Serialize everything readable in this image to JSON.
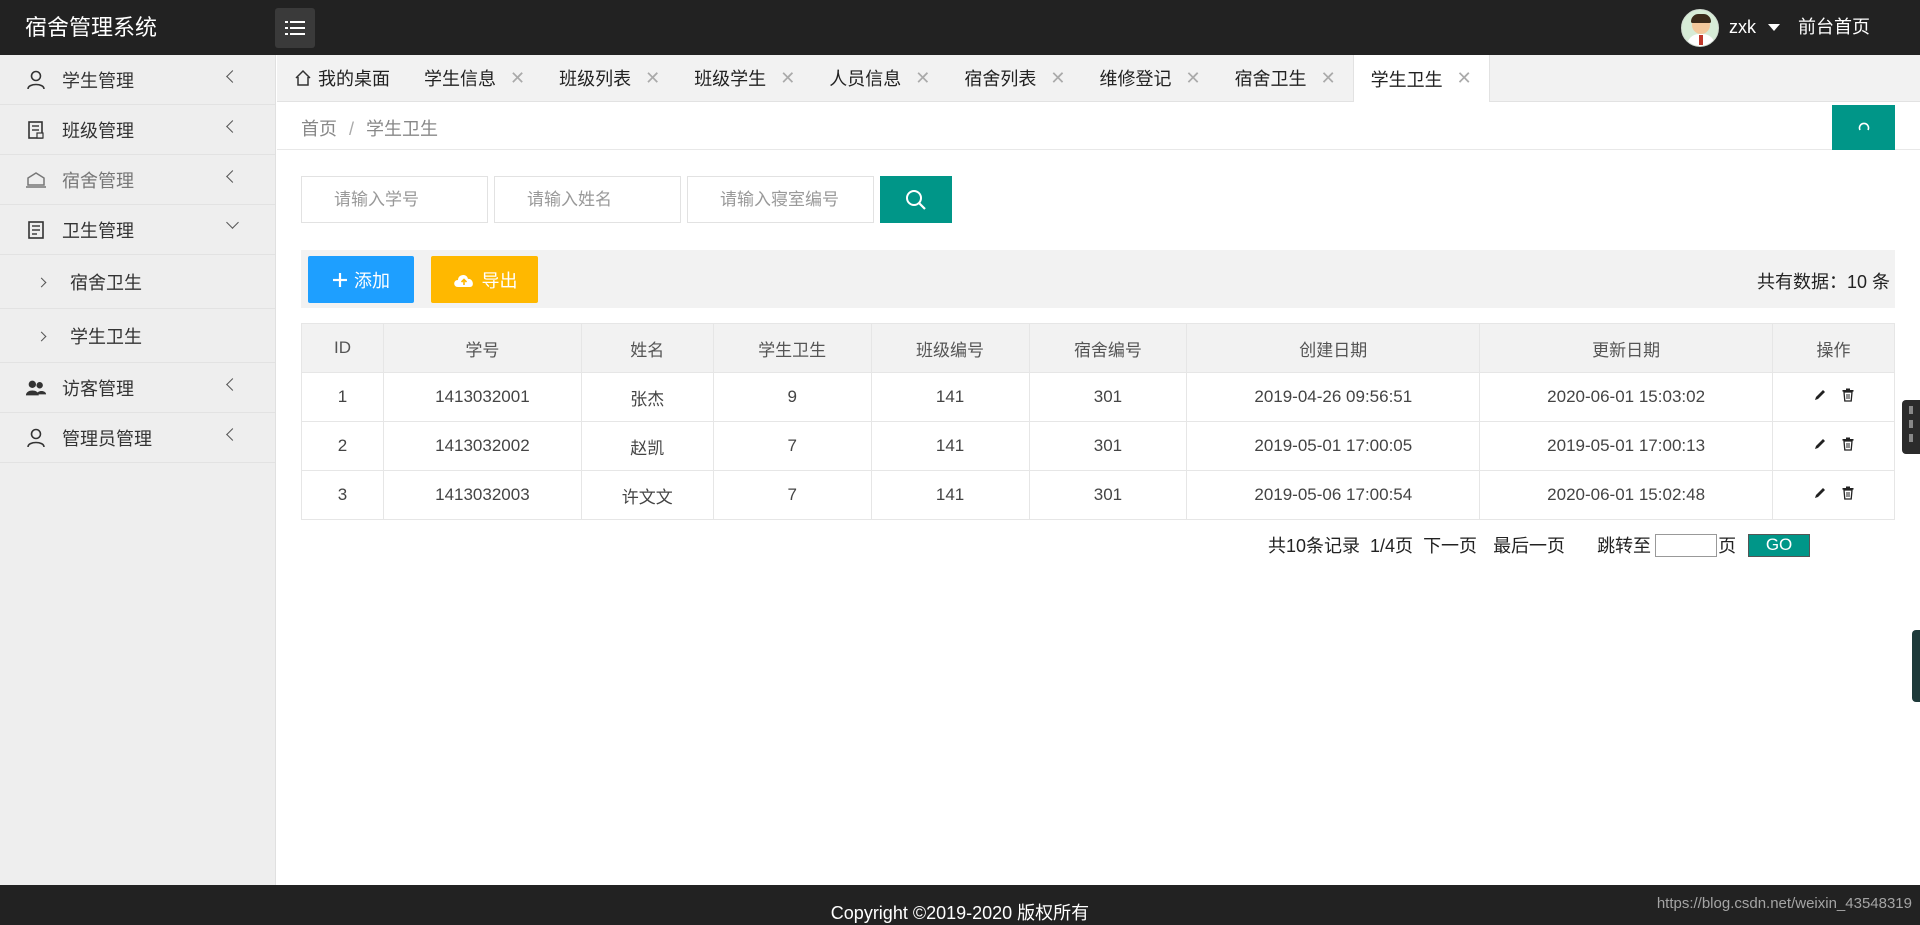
{
  "app": {
    "title": "宿舍管理系统"
  },
  "header": {
    "username": "zxk",
    "front_link": "前台首页"
  },
  "sidebar": {
    "items": [
      {
        "label": "学生管理",
        "icon": "user-icon"
      },
      {
        "label": "班级管理",
        "icon": "class-icon"
      },
      {
        "label": "宿舍管理",
        "icon": "dorm-icon"
      },
      {
        "label": "卫生管理",
        "icon": "hygiene-icon",
        "expanded": true
      },
      {
        "label": "访客管理",
        "icon": "visitor-icon"
      },
      {
        "label": "管理员管理",
        "icon": "admin-icon"
      }
    ],
    "subitems": [
      {
        "label": "宿舍卫生"
      },
      {
        "label": "学生卫生"
      }
    ]
  },
  "tabs": [
    {
      "label": "我的桌面"
    },
    {
      "label": "学生信息"
    },
    {
      "label": "班级列表"
    },
    {
      "label": "班级学生"
    },
    {
      "label": "人员信息"
    },
    {
      "label": "宿舍列表"
    },
    {
      "label": "维修登记"
    },
    {
      "label": "宿舍卫生"
    },
    {
      "label": "学生卫生",
      "active": true
    }
  ],
  "breadcrumb": {
    "home": "首页",
    "separator": "/",
    "current": "学生卫生"
  },
  "search": {
    "student_no_placeholder": "请输入学号",
    "name_placeholder": "请输入姓名",
    "room_placeholder": "请输入寝室编号"
  },
  "toolbar": {
    "add_label": "添加",
    "export_label": "导出",
    "total_text": "共有数据：10 条"
  },
  "table": {
    "headers": [
      "ID",
      "学号",
      "姓名",
      "学生卫生",
      "班级编号",
      "宿舍编号",
      "创建日期",
      "更新日期",
      "操作"
    ],
    "rows": [
      [
        "1",
        "1413032001",
        "张杰",
        "9",
        "141",
        "301",
        "2019-04-26 09:56:51",
        "2020-06-01 15:03:02"
      ],
      [
        "2",
        "1413032002",
        "赵凯",
        "7",
        "141",
        "301",
        "2019-05-01 17:00:05",
        "2019-05-01 17:00:13"
      ],
      [
        "3",
        "1413032003",
        "许文文",
        "7",
        "141",
        "301",
        "2019-05-06 17:00:54",
        "2020-06-01 15:02:48"
      ]
    ]
  },
  "pagination": {
    "summary": "共10条记录",
    "page_info": "1/4页",
    "next": "下一页",
    "last": "最后一页",
    "jump_label": "跳转至",
    "page_unit": "页",
    "go": "GO"
  },
  "footer": {
    "copyright": "Copyright ©2019-2020 版权所有",
    "watermark": "https://blog.csdn.net/weixin_43548319"
  },
  "colors": {
    "teal": "#009688",
    "blue": "#1e9fff",
    "orange": "#ffb800",
    "header_bg": "#222222"
  }
}
